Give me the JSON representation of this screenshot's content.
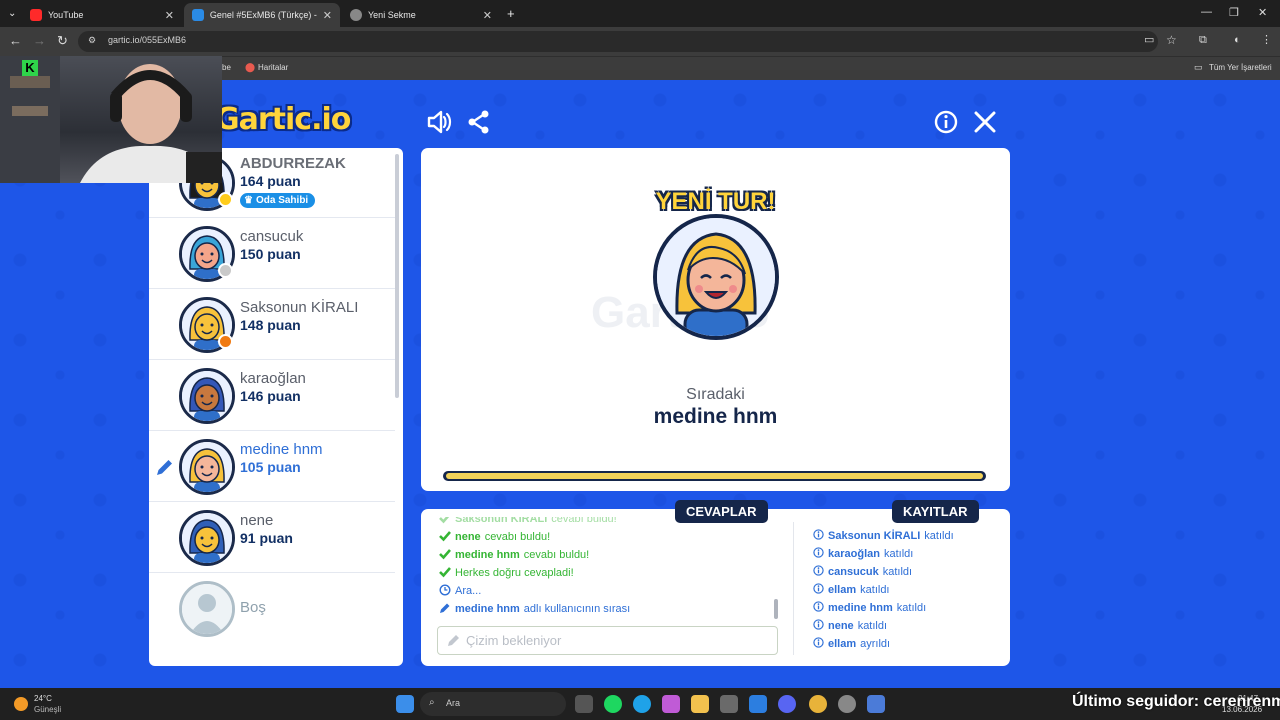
{
  "browser": {
    "tabs": [
      {
        "label": "YouTube",
        "active": false
      },
      {
        "label": "Genel #5ExMB6 (Türkçe) - G",
        "active": true
      },
      {
        "label": "Yeni Sekme",
        "active": false
      }
    ],
    "new_tab": "+",
    "url": "gartic.io/055ExMB6",
    "bookmarks": [
      "be",
      "Haritalar"
    ],
    "all_bookmarks": "Tüm Yer İşaretleri"
  },
  "game": {
    "logo": "Gartic.io",
    "players": [
      {
        "name": "ABDURREZAK",
        "score": "164 puan",
        "badge": "Oda Sahibi",
        "status_color": "#ffcc1a",
        "skin": "#f7c23b",
        "hair": "#1b1b1b"
      },
      {
        "name": "cansucuk",
        "score": "150 puan",
        "status_color": "#c9c9c9",
        "skin": "#f4a58a",
        "hair": "#3aa5d8"
      },
      {
        "name": "Saksonun KİRALI",
        "score": "148 puan",
        "status_color": "#f07a12",
        "skin": "#f7c23b",
        "hair": "#f7c23b"
      },
      {
        "name": "karaoğlan",
        "score": "146 puan",
        "skin": "#c8783e",
        "hair": "#3457b8"
      },
      {
        "name": "medine hnm",
        "score": "105 puan",
        "drawing": true,
        "skin": "#f4b69a",
        "hair": "#f7c23b"
      },
      {
        "name": "nene",
        "score": "91 puan",
        "skin": "#f7c23b",
        "hair": "#2f5fb8"
      },
      {
        "name": "Boş",
        "empty": true
      }
    ],
    "round": {
      "title": "YENİ TUR!",
      "watermark": "Gartic.io",
      "next_label": "Sıradaki",
      "next_player": "medine hnm",
      "progress": 1.0
    },
    "tabs": {
      "answers": "CEVAPLAR",
      "logs": "KAYITLAR"
    },
    "answers": [
      {
        "icon": "check",
        "name": "Saksonun KİRALI",
        "text": "cevabı buldu!",
        "faded": true
      },
      {
        "icon": "check",
        "name": "nene",
        "text": "cevabı buldu!"
      },
      {
        "icon": "check",
        "name": "medine hnm",
        "text": "cevabı buldu!"
      },
      {
        "icon": "check",
        "name": "",
        "text": "Herkes doğru cevapladi!"
      },
      {
        "icon": "clock",
        "name": "",
        "text": "Ara...",
        "blue": true
      },
      {
        "icon": "pencil",
        "name": "medine hnm",
        "text": "adlı kullanıcının sırası",
        "blue": true
      }
    ],
    "chat_placeholder": "Çizim bekleniyor",
    "logs": [
      {
        "name": "Saksonun KİRALI",
        "action": "katıldı"
      },
      {
        "name": "karaoğlan",
        "action": "katıldı"
      },
      {
        "name": "cansucuk",
        "action": "katıldı"
      },
      {
        "name": "ellam",
        "action": "katıldı"
      },
      {
        "name": "medine hnm",
        "action": "katıldı"
      },
      {
        "name": "nene",
        "action": "katıldı"
      },
      {
        "name": "ellam",
        "action": "ayrıldı"
      }
    ]
  },
  "taskbar": {
    "temperature": "24°C",
    "weather": "Güneşli",
    "search_label": "Ara",
    "clock": "21:47",
    "date": "13.06.2026"
  },
  "overlay": {
    "follower": "Último seguidor: cerenrenm"
  },
  "colors": {
    "page_bg": "#1e56e8",
    "navy": "#15264a",
    "green": "#35b534",
    "blue_text": "#2f6fd6",
    "yellow": "#ffd43b"
  }
}
